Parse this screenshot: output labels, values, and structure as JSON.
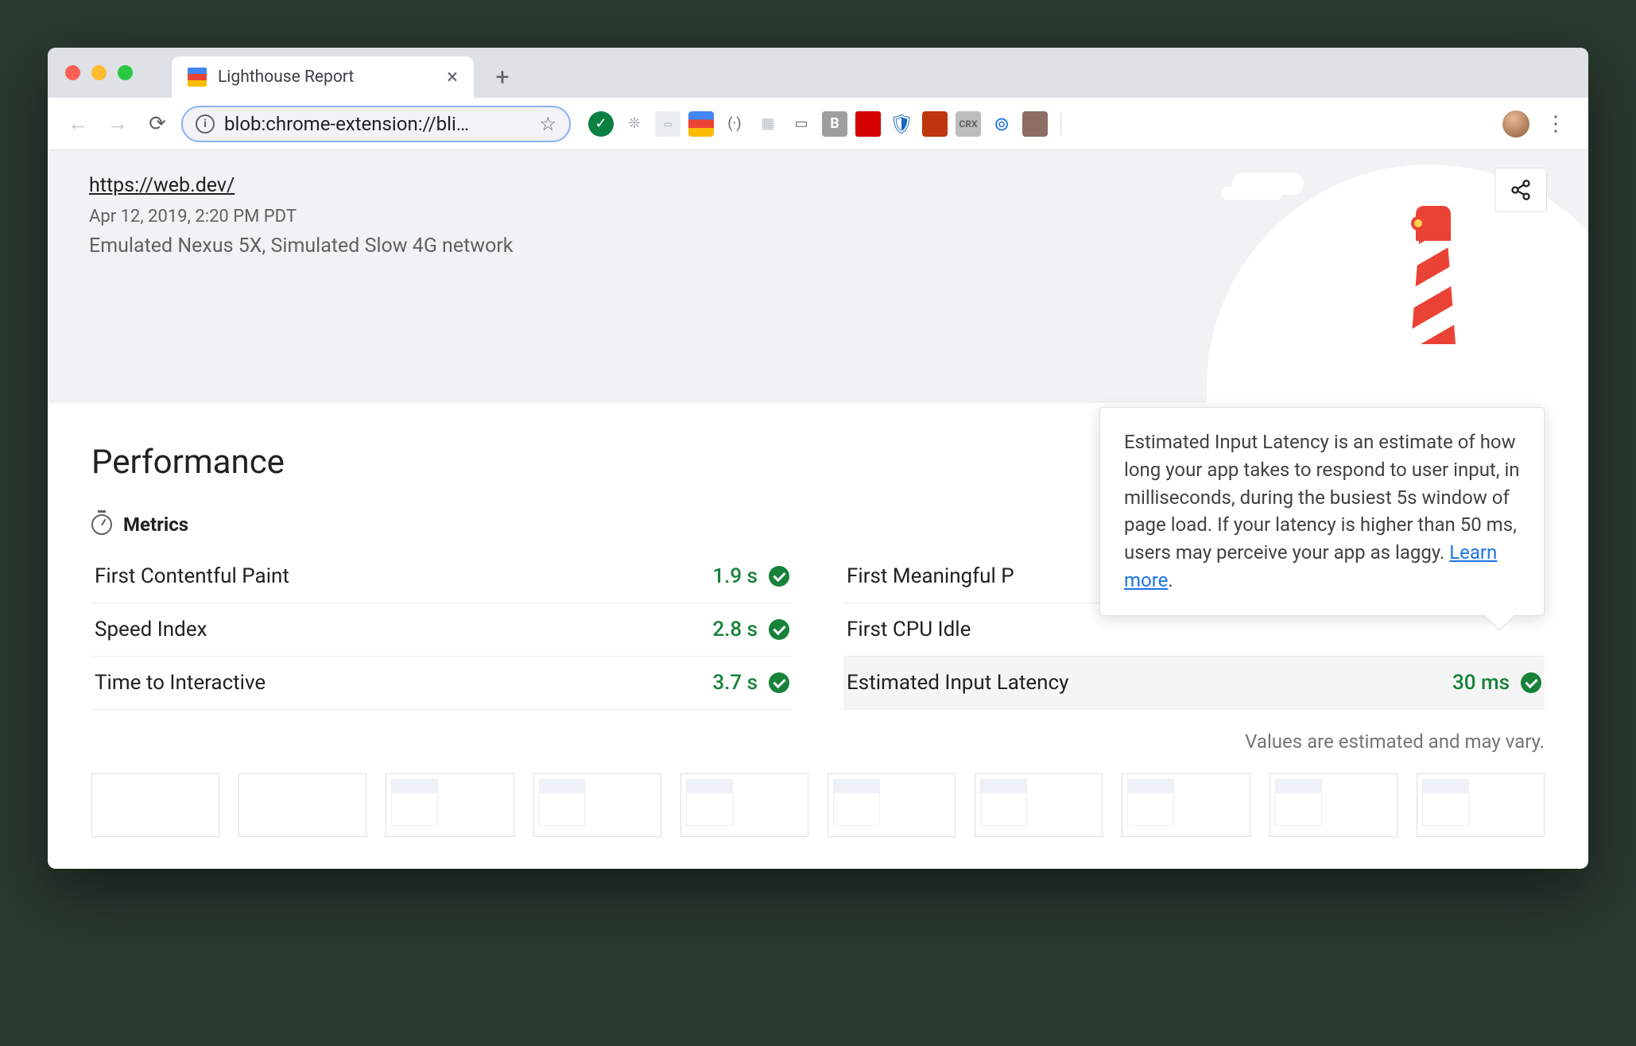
{
  "browser": {
    "tab_title": "Lighthouse Report",
    "url_display": "blob:chrome-extension://bli…"
  },
  "report": {
    "tested_url": "https://web.dev/",
    "timestamp": "Apr 12, 2019, 2:20 PM PDT",
    "environment": "Emulated Nexus 5X, Simulated Slow 4G network"
  },
  "section": {
    "title": "Performance",
    "metrics_label": "Metrics",
    "disclaimer": "Values are estimated and may vary."
  },
  "metrics": {
    "left": [
      {
        "name": "First Contentful Paint",
        "value": "1.9 s"
      },
      {
        "name": "Speed Index",
        "value": "2.8 s"
      },
      {
        "name": "Time to Interactive",
        "value": "3.7 s"
      }
    ],
    "right": [
      {
        "name": "First Meaningful P",
        "value": ""
      },
      {
        "name": "First CPU Idle",
        "value": ""
      },
      {
        "name": "Estimated Input Latency",
        "value": "30 ms"
      }
    ]
  },
  "tooltip": {
    "body": "Estimated Input Latency is an estimate of how long your app takes to respond to user input, in milliseconds, during the busiest 5s window of page load. If your latency is higher than 50 ms, users may perceive your app as laggy. ",
    "link": "Learn more"
  }
}
